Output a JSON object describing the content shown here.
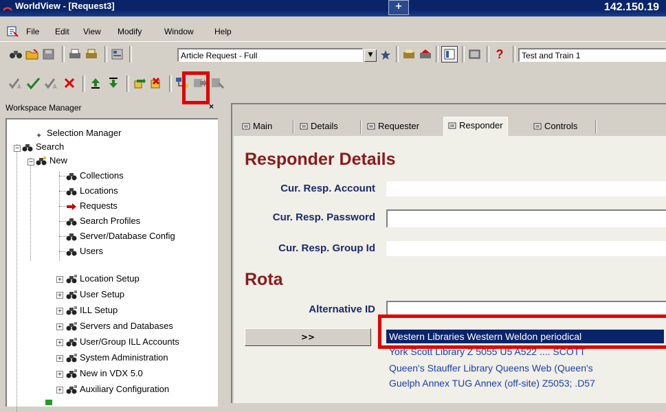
{
  "window": {
    "title": "WorldView - [Request3]",
    "address": "142.150.19",
    "tab_glyph": "+"
  },
  "menu": [
    "File",
    "Edit",
    "View",
    "Modify",
    "Window",
    "Help"
  ],
  "toolbar": {
    "request_type": "Article Request - Full",
    "profile": "Test and Train 1",
    "help_glyph": "?"
  },
  "workspace": {
    "header": "Workspace Manager",
    "close_glyph": "×",
    "items": [
      {
        "label": "Selection Manager"
      },
      {
        "label": "Search"
      },
      {
        "label": "New"
      },
      {
        "label": "Collections"
      },
      {
        "label": "Locations"
      },
      {
        "label": "Requests"
      },
      {
        "label": "Search Profiles"
      },
      {
        "label": "Server/Database Config"
      },
      {
        "label": "Users"
      },
      {
        "label": "Location Setup"
      },
      {
        "label": "User Setup"
      },
      {
        "label": "ILL Setup"
      },
      {
        "label": "Servers and Databases"
      },
      {
        "label": "User/Group ILL Accounts"
      },
      {
        "label": "System Administration"
      },
      {
        "label": "New in VDX 5.0"
      },
      {
        "label": "Auxiliary Configuration"
      }
    ]
  },
  "tabs": [
    {
      "label": "Main"
    },
    {
      "label": "Details"
    },
    {
      "label": "Requester"
    },
    {
      "label": "Responder"
    },
    {
      "label": "Controls"
    }
  ],
  "responder": {
    "heading": "Responder Details",
    "account_label": "Cur. Resp. Account",
    "account_value": "",
    "password_label": "Cur. Resp. Password",
    "password_value": "",
    "group_label": "Cur. Resp. Group Id",
    "group_value": ""
  },
  "rota": {
    "heading": "Rota",
    "alt_id_label": "Alternative ID",
    "alt_id_value": "",
    "move_button": ">>",
    "items": [
      "Western Libraries Western Weldon periodical",
      "York Scott Library Z 5055 U5 A522 .... SCOTT",
      "Queen's Stauffer Library Queens Web (Queen's",
      "Guelph Annex TUG Annex (off-site) Z5053; .D57"
    ],
    "selected_index": 0
  },
  "colors": {
    "titlebar": "#0a246a",
    "heading_red": "#8b1a1a",
    "label_blue": "#1a2a6a",
    "highlight_box": "#e00000",
    "selection": "#0a246a",
    "link_blue": "#1a3fb0"
  }
}
